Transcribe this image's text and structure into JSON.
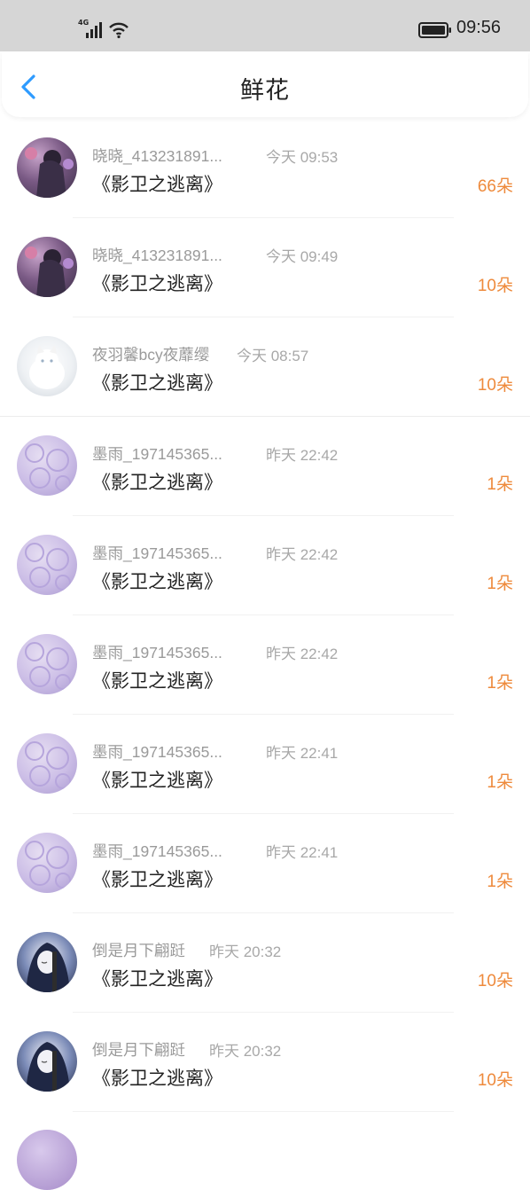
{
  "status_bar": {
    "network": "4G",
    "time": "09:56"
  },
  "header": {
    "title": "鲜花"
  },
  "rows": [
    {
      "user": "晓晓_413231891...",
      "time": "今天 09:53",
      "book": "《影卫之逃离》",
      "count": "66朵"
    },
    {
      "user": "晓晓_413231891...",
      "time": "今天 09:49",
      "book": "《影卫之逃离》",
      "count": "10朵"
    },
    {
      "user": "夜羽馨bcy夜蘼缨",
      "time": "今天 08:57",
      "book": "《影卫之逃离》",
      "count": "10朵"
    },
    {
      "user": "墨雨_197145365...",
      "time": "昨天 22:42",
      "book": "《影卫之逃离》",
      "count": "1朵"
    },
    {
      "user": "墨雨_197145365...",
      "time": "昨天 22:42",
      "book": "《影卫之逃离》",
      "count": "1朵"
    },
    {
      "user": "墨雨_197145365...",
      "time": "昨天 22:42",
      "book": "《影卫之逃离》",
      "count": "1朵"
    },
    {
      "user": "墨雨_197145365...",
      "time": "昨天 22:41",
      "book": "《影卫之逃离》",
      "count": "1朵"
    },
    {
      "user": "墨雨_197145365...",
      "time": "昨天 22:41",
      "book": "《影卫之逃离》",
      "count": "1朵"
    },
    {
      "user": "倒是月下翩跹",
      "time": "昨天 20:32",
      "book": "《影卫之逃离》",
      "count": "10朵"
    },
    {
      "user": "倒是月下翩跹",
      "time": "昨天 20:32",
      "book": "《影卫之逃离》",
      "count": "10朵"
    }
  ],
  "colors": {
    "accent": "#ee8a3c",
    "back": "#2e9bff"
  },
  "icons": {
    "back": "chevron-left-icon",
    "wifi": "wifi-icon",
    "battery": "battery-icon",
    "signal": "signal-icon"
  }
}
